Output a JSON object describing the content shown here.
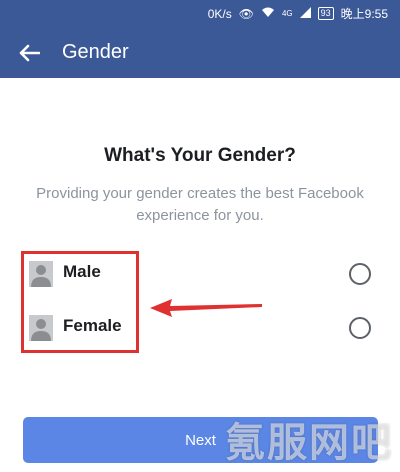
{
  "status_bar": {
    "network_speed": "0K/s",
    "eye_icon": "eye-icon",
    "wifi_icon": "wifi-icon",
    "network_type": "4G",
    "signal_icon": "signal-icon",
    "battery": "93",
    "time": "晚上9:55"
  },
  "app_bar": {
    "back_icon": "arrow-left-icon",
    "title": "Gender"
  },
  "main": {
    "heading": "What's Your Gender?",
    "description": "Providing your gender creates the best Facebook experience for you.",
    "options": [
      {
        "label": "Male",
        "icon": "person-icon",
        "selected": false
      },
      {
        "label": "Female",
        "icon": "person-icon",
        "selected": false
      }
    ],
    "next_label": "Next"
  },
  "annotations": {
    "box_color": "#e03131",
    "arrow_color": "#e03131"
  },
  "watermark": "氪服网吧",
  "colors": {
    "brand": "#3b5897",
    "button": "#5b86e5"
  }
}
